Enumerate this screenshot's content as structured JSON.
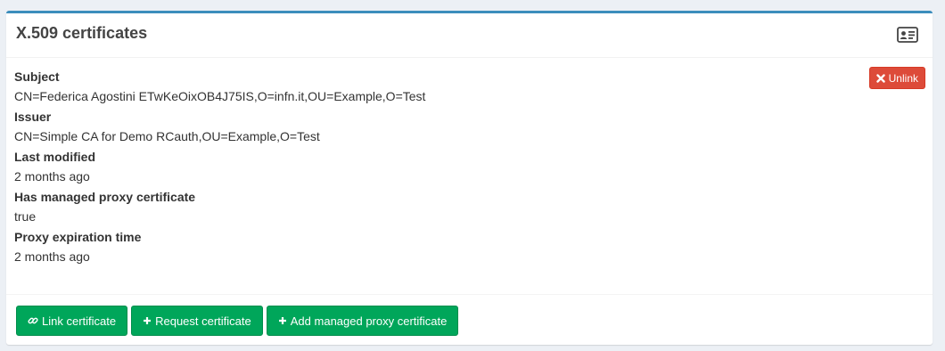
{
  "box": {
    "title": "X.509 certificates",
    "header_icon": "id-card-icon"
  },
  "certificate": {
    "unlink_label": "Unlink",
    "fields": [
      {
        "label": "Subject",
        "value": "CN=Federica Agostini ETwKeOixOB4J75IS,O=infn.it,OU=Example,O=Test"
      },
      {
        "label": "Issuer",
        "value": "CN=Simple CA for Demo RCauth,OU=Example,O=Test"
      },
      {
        "label": "Last modified",
        "value": "2 months ago"
      },
      {
        "label": "Has managed proxy certificate",
        "value": "true"
      },
      {
        "label": "Proxy expiration time",
        "value": "2 months ago"
      }
    ]
  },
  "footer": {
    "link_label": "Link certificate",
    "request_label": "Request certificate",
    "add_proxy_label": "Add managed proxy certificate"
  },
  "colors": {
    "accent": "#3c8dbc",
    "danger": "#dd4b39",
    "success": "#00a65a"
  }
}
